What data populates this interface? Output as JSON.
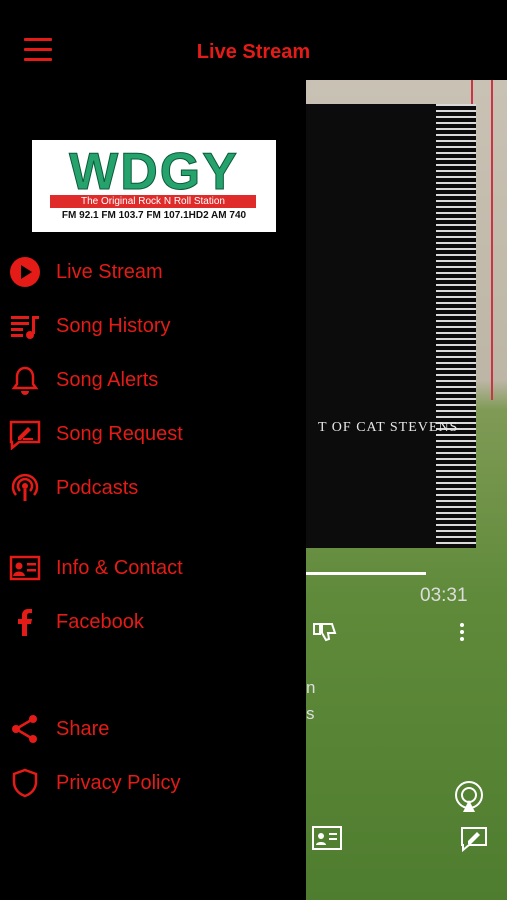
{
  "header": {
    "title": "Live Stream",
    "menu_icon": "hamburger-menu-icon"
  },
  "logo": {
    "name": "WDGY",
    "tagline": "The Original Rock N Roll Station",
    "frequencies": "FM 92.1  FM 103.7  FM 107.1HD2  AM 740"
  },
  "menu": {
    "items": [
      {
        "label": "Live Stream",
        "icon": "play-circle-icon"
      },
      {
        "label": "Song History",
        "icon": "playlist-icon"
      },
      {
        "label": "Song Alerts",
        "icon": "bell-icon"
      },
      {
        "label": "Song Request",
        "icon": "edit-message-icon"
      },
      {
        "label": "Podcasts",
        "icon": "podcast-icon"
      },
      {
        "label": "Info & Contact",
        "icon": "contact-card-icon"
      },
      {
        "label": "Facebook",
        "icon": "facebook-icon"
      },
      {
        "label": "Share",
        "icon": "share-icon"
      },
      {
        "label": "Privacy Policy",
        "icon": "shield-icon"
      }
    ]
  },
  "player": {
    "album_text": "T OF CAT STEVENS",
    "time": "03:31",
    "track_line1": "n",
    "track_line2": "s"
  },
  "colors": {
    "accent": "#e41b17",
    "background": "#000000"
  }
}
